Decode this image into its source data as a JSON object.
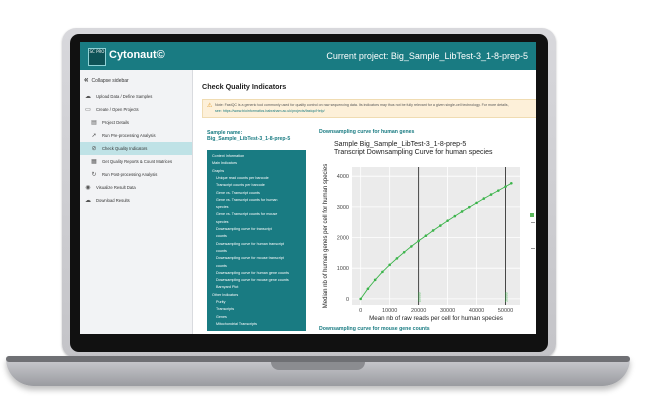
{
  "app": {
    "logo_text": "SC PRO",
    "name": "Cytonaut©",
    "project_label": "Current project: Big_Sample_LibTest-3_1-8-prep-5"
  },
  "sidebar": {
    "collapse_label": "Collapse sidebar",
    "items": [
      {
        "label": "Upload Data / Define Samples",
        "icon": "cloud-upload-icon"
      },
      {
        "label": "Create / Open Projects",
        "icon": "folder-icon"
      },
      {
        "label": "Project Details",
        "icon": "document-icon"
      },
      {
        "label": "Run Pre-processing Analysis",
        "icon": "rocket-icon"
      },
      {
        "label": "Check Quality Indicators",
        "icon": "check-circle-icon",
        "active": true
      },
      {
        "label": "Get Quality Reports & Count Matrices",
        "icon": "table-icon"
      },
      {
        "label": "Run Post-processing Analysis",
        "icon": "refresh-icon"
      },
      {
        "label": "Visualize Result Data",
        "icon": "eye-icon"
      },
      {
        "label": "Download Results",
        "icon": "cloud-download-icon"
      }
    ]
  },
  "main": {
    "heading": "Check Quality Indicators",
    "note_line1": "Note: FastQC is a generic tool commonly used for quality control on raw sequencing data. Its indicators may thus not be fully relevant for a given single-cell technology. For more details,",
    "note_line2": "see: https://www.bioinformatics.babraham.ac.uk/projects/fastqc/Help/",
    "sample_label": "Sample name:",
    "sample_name": "Big_Sample_LibTest-3_1-8-prep-5",
    "toc": [
      {
        "label": "Context Information",
        "indent": false
      },
      {
        "label": "Main Indicators",
        "indent": false
      },
      {
        "label": "Graphs",
        "indent": false
      },
      {
        "label": "Unique read counts per barcode",
        "indent": true
      },
      {
        "label": "Transcript counts per barcode",
        "indent": true
      },
      {
        "label": "Gene vs. Transcript counts",
        "indent": true
      },
      {
        "label": "Gene vs. Transcript counts for human",
        "indent": true
      },
      {
        "label": "species",
        "indent": true
      },
      {
        "label": "Gene vs. Transcript counts for mouse",
        "indent": true
      },
      {
        "label": "species",
        "indent": true
      },
      {
        "label": "Downsampling curve for transcript",
        "indent": true
      },
      {
        "label": "counts",
        "indent": true
      },
      {
        "label": "Downsampling curve for human transcript",
        "indent": true
      },
      {
        "label": "counts",
        "indent": true
      },
      {
        "label": "Downsampling curve for mouse transcript",
        "indent": true
      },
      {
        "label": "counts",
        "indent": true
      },
      {
        "label": "Downsampling curve for human gene counts",
        "indent": true
      },
      {
        "label": "Downsampling curve for mouse gene counts",
        "indent": true
      },
      {
        "label": "Barnyard Plot",
        "indent": true
      },
      {
        "label": "Other Indicators",
        "indent": false
      },
      {
        "label": "Purity",
        "indent": true
      },
      {
        "label": "Transcripts",
        "indent": true
      },
      {
        "label": "Genes",
        "indent": true
      },
      {
        "label": "Mitochondrial Transcripts",
        "indent": true
      }
    ],
    "section_title": "Downsampling curve for human genes",
    "next_section_title": "Downsampling curve for mouse gene counts"
  },
  "chart_data": {
    "type": "line",
    "title": "Sample Big_Sample_LibTest-3_1-8-prep-5",
    "subtitle": "Transcript Downsampling Curve for human species",
    "xlabel": "Mean nb of raw reads per cell for human species",
    "ylabel": "Median nb of human genes per cell for human species",
    "xlim": [
      -3000,
      55000
    ],
    "ylim": [
      -200,
      4300
    ],
    "xticks": [
      0,
      10000,
      20000,
      30000,
      40000,
      50000
    ],
    "yticks": [
      0,
      1000,
      2000,
      3000,
      4000
    ],
    "grid": true,
    "color": "#3cb44b",
    "x": [
      0,
      2500,
      5000,
      7500,
      10000,
      12500,
      15000,
      17500,
      20000,
      22500,
      25000,
      27500,
      30000,
      32500,
      35000,
      37500,
      40000,
      42500,
      45000,
      47500,
      50000,
      52000
    ],
    "y": [
      0,
      330,
      620,
      880,
      1110,
      1320,
      1520,
      1710,
      1890,
      2060,
      2230,
      2390,
      2550,
      2700,
      2850,
      2990,
      3130,
      3270,
      3400,
      3530,
      3660,
      3770
    ],
    "vlines": [
      {
        "x": 20000,
        "label": "20000"
      },
      {
        "x": 50000,
        "label": "50000"
      }
    ]
  }
}
